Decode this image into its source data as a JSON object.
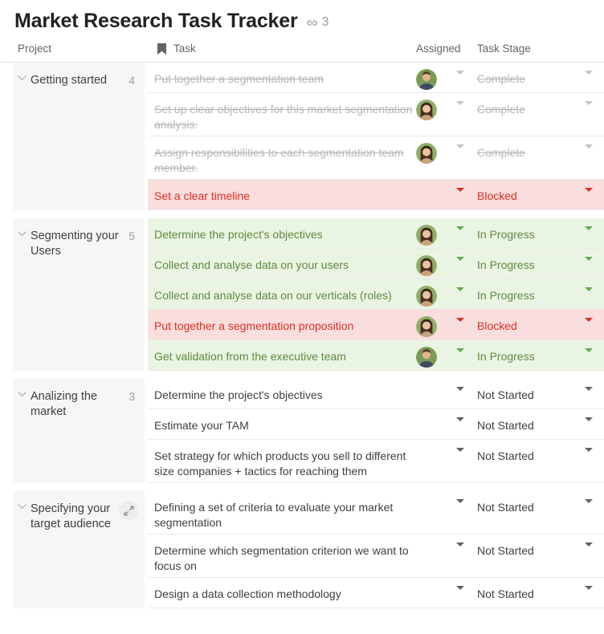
{
  "header": {
    "title": "Market Research Task Tracker",
    "link_icon": "link-icon",
    "link_count": "3"
  },
  "columns": {
    "project": "Project",
    "task": "Task",
    "task_icon": "bookmark-icon",
    "assigned": "Assigned",
    "stage": "Task Stage"
  },
  "projects": [
    {
      "name": "Getting started",
      "count": "4",
      "expandable": false,
      "tasks": [
        {
          "title": "Put together a segmentation team",
          "stage": "Complete",
          "state": "done",
          "avatar": "male",
          "assigned_caret": "gray-light",
          "stage_caret": "gray-light"
        },
        {
          "title": "Set up clear objectives for this market segmentation analysis.",
          "stage": "Complete",
          "state": "done",
          "avatar": "female",
          "assigned_caret": "gray-light",
          "stage_caret": "gray-light"
        },
        {
          "title": "Assign responsibilities to each segmentation team member.",
          "stage": "Complete",
          "state": "done",
          "avatar": "female",
          "assigned_caret": "gray-light",
          "stage_caret": "gray-light"
        },
        {
          "title": "Set a clear timeline",
          "stage": "Blocked",
          "state": "red",
          "avatar": "none",
          "assigned_caret": "red",
          "stage_caret": "red"
        }
      ]
    },
    {
      "name": "Segmenting your Users",
      "count": "5",
      "expandable": false,
      "tasks": [
        {
          "title": "Determine the project's objectives",
          "stage": "In Progress",
          "state": "green",
          "avatar": "female",
          "assigned_caret": "green",
          "stage_caret": "green"
        },
        {
          "title": "Collect and analyse data on your users",
          "stage": "In Progress",
          "state": "green",
          "avatar": "female",
          "assigned_caret": "green",
          "stage_caret": "green"
        },
        {
          "title": "Collect and analyse data on our verticals (roles)",
          "stage": "In Progress",
          "state": "green",
          "avatar": "female",
          "assigned_caret": "green",
          "stage_caret": "green"
        },
        {
          "title": "Put together a segmentation proposition",
          "stage": "Blocked",
          "state": "red",
          "avatar": "female",
          "assigned_caret": "red",
          "stage_caret": "red"
        },
        {
          "title": "Get validation from the executive team",
          "stage": "In Progress",
          "state": "green",
          "avatar": "male",
          "assigned_caret": "green",
          "stage_caret": "green"
        }
      ]
    },
    {
      "name": "Analizing the market",
      "count": "3",
      "expandable": false,
      "tasks": [
        {
          "title": "Determine the project's objectives",
          "stage": "Not Started",
          "state": "plain",
          "avatar": "none",
          "assigned_caret": "dark",
          "stage_caret": "dark"
        },
        {
          "title": "Estimate your TAM",
          "stage": "Not Started",
          "state": "plain",
          "avatar": "none",
          "assigned_caret": "dark",
          "stage_caret": "dark"
        },
        {
          "title": "Set strategy for which products you sell to different size companies + tactics for reaching them",
          "stage": "Not Started",
          "state": "plain",
          "avatar": "none",
          "assigned_caret": "dark",
          "stage_caret": "dark"
        }
      ]
    },
    {
      "name": "Specifying your target audience",
      "count": "",
      "expandable": true,
      "expand_icon": "expand-icon",
      "tasks": [
        {
          "title": "Defining a set of criteria to evaluate your market segmentation",
          "stage": "Not Started",
          "state": "plain",
          "avatar": "none",
          "assigned_caret": "dark",
          "stage_caret": "dark"
        },
        {
          "title": "Determine which segmentation criterion we want to focus on",
          "stage": "Not Started",
          "state": "plain",
          "avatar": "none",
          "assigned_caret": "dark",
          "stage_caret": "dark"
        },
        {
          "title": "Design a data collection methodology",
          "stage": "Not Started",
          "state": "plain",
          "avatar": "none",
          "assigned_caret": "dark",
          "stage_caret": "dark"
        }
      ]
    }
  ],
  "colors": {
    "green_row": "#eaf4e3",
    "red_row": "#fadddd",
    "green_text": "#5f8a3f",
    "red_text": "#d93025",
    "project_cell": "#f6f6f6"
  }
}
